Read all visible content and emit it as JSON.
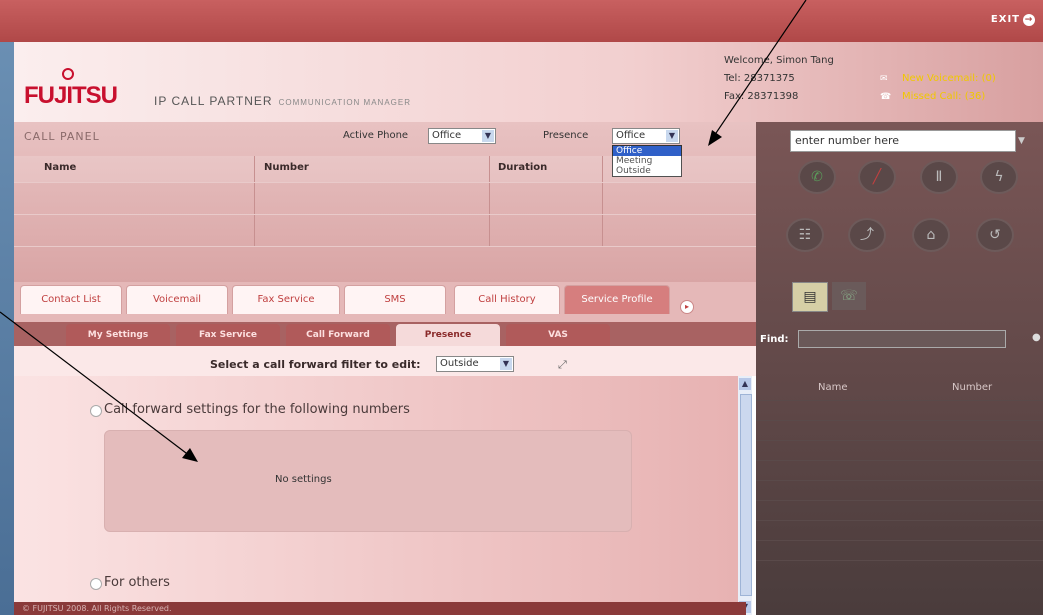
{
  "topbar": {
    "exit_label": "EXIT"
  },
  "header": {
    "logo": "FUJITSU",
    "app_title": "IP CALL PARTNER",
    "app_subtitle": "COMMUNICATION MANAGER",
    "welcome": "Welcome, Simon Tang",
    "tel": "Tel: 28371375",
    "fax": "Fax: 28371398",
    "new_voicemail": "New Voicemail: (0)",
    "missed_call": "Missed Call: (36)"
  },
  "call_panel": {
    "title": "CALL PANEL",
    "active_phone_label": "Active Phone",
    "active_phone_value": "Office",
    "presence_label": "Presence",
    "presence_value": "Office",
    "presence_options": [
      "Office",
      "Meeting",
      "Outside"
    ],
    "columns": [
      "Name",
      "Number",
      "Duration"
    ]
  },
  "tabs": [
    "Contact List",
    "Voicemail",
    "Fax Service",
    "SMS",
    "Call History",
    "Service Profile"
  ],
  "subtabs": [
    "My Settings",
    "Fax Service",
    "Call Forward",
    "Presence",
    "VAS"
  ],
  "filter": {
    "label": "Select a call forward filter to edit:",
    "value": "Outside"
  },
  "content": {
    "radio1_label": "Call forward settings for the following numbers",
    "no_settings": "No settings",
    "radio2_label": "For others"
  },
  "footer": {
    "text": "© FUJITSU 2008. All Rights Reserved."
  },
  "right_panel": {
    "number_placeholder": "enter number here",
    "find_label": "Find:",
    "col_name": "Name",
    "col_number": "Number"
  },
  "colors": {
    "brand_red": "#c8102e",
    "topbar": "#b04848",
    "notif_yellow": "#f0c800"
  }
}
